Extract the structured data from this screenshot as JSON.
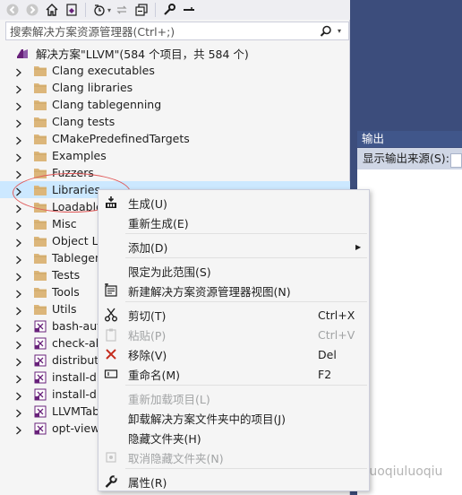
{
  "toolbar": {
    "buttons": [
      "back-icon",
      "forward-icon",
      "home-icon",
      "switch-views-icon",
      "pending-changes-icon",
      "sync-icon",
      "collapse-all-icon",
      "properties-icon",
      "preview-icon"
    ]
  },
  "search": {
    "placeholder": "搜索解决方案资源管理器(Ctrl+;)"
  },
  "tree": {
    "root": "解决方案\"LLVM\"(584 个项目，共 584 个)",
    "folders": [
      "Clang executables",
      "Clang libraries",
      "Clang tablegenning",
      "Clang tests",
      "CMakePredefinedTargets",
      "Examples",
      "Fuzzers",
      "Libraries",
      "Loadable",
      "Misc",
      "Object Li",
      "Tablegen",
      "Tests",
      "Tools",
      "Utils"
    ],
    "projects": [
      "bash-aut",
      "check-all",
      "distributi",
      "install-di",
      "install-di",
      "LLVMTab",
      "opt-view"
    ]
  },
  "output": {
    "title": "输出",
    "source_label": "显示输出来源(S):"
  },
  "menu": {
    "items": [
      {
        "label": "生成(U)",
        "icon": "build-icon",
        "disabled": false
      },
      {
        "label": "重新生成(E)",
        "icon": "",
        "disabled": false
      },
      {
        "label": "添加(D)",
        "icon": "",
        "disabled": false,
        "submenu": true
      },
      {
        "label": "限定为此范围(S)",
        "icon": "",
        "disabled": false
      },
      {
        "label": "新建解决方案资源管理器视图(N)",
        "icon": "new-view-icon",
        "disabled": false
      },
      {
        "label": "剪切(T)",
        "icon": "cut-icon",
        "shortcut": "Ctrl+X",
        "disabled": false
      },
      {
        "label": "粘贴(P)",
        "icon": "paste-icon",
        "shortcut": "Ctrl+V",
        "disabled": true
      },
      {
        "label": "移除(V)",
        "icon": "remove-icon",
        "shortcut": "Del",
        "disabled": false
      },
      {
        "label": "重命名(M)",
        "icon": "rename-icon",
        "shortcut": "F2",
        "disabled": false
      },
      {
        "label": "重新加载项目(L)",
        "icon": "",
        "disabled": true
      },
      {
        "label": "卸载解决方案文件夹中的项目(J)",
        "icon": "",
        "disabled": false
      },
      {
        "label": "隐藏文件夹(H)",
        "icon": "",
        "disabled": false
      },
      {
        "label": "取消隐藏文件夹(N)",
        "icon": "unhide-icon",
        "disabled": true
      },
      {
        "label": "属性(R)",
        "icon": "properties-icon",
        "disabled": false
      }
    ]
  },
  "watermark": "知乎 @luoqiuluoqiu",
  "colors": {
    "selection": "#cce8ff",
    "accent_purple": "#68217a",
    "folder": "#dcb67a",
    "remove_red": "#c42b1c"
  }
}
